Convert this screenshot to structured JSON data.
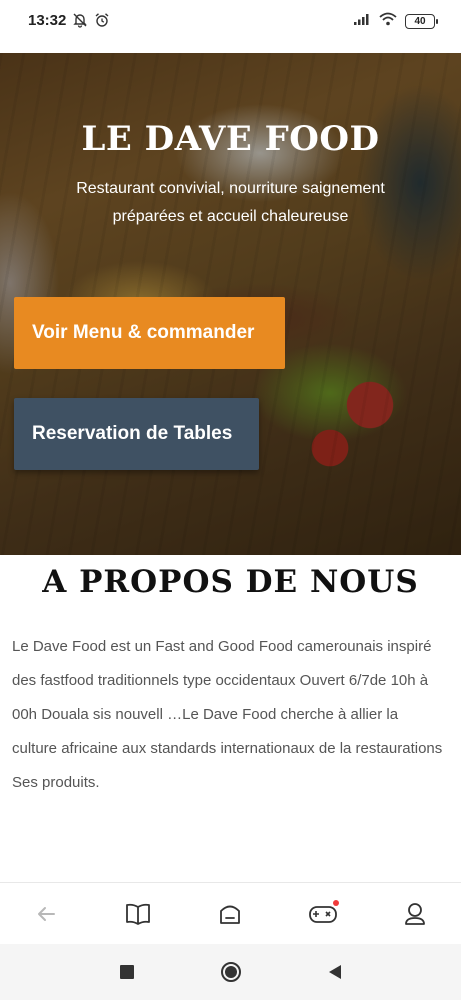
{
  "status_bar": {
    "time": "13:32",
    "battery": "40"
  },
  "hero": {
    "title": "LE DAVE FOOD",
    "subtitle": "Restaurant convivial, nourriture saignement préparées et accueil chaleureuse",
    "menu_button_label": "Voir Menu & commander",
    "reservation_button_label": "Reservation de Tables",
    "colors": {
      "menu_button": "#e88a21",
      "reservation_button": "#3f5163"
    }
  },
  "about": {
    "title": "A PROPOS DE NOUS",
    "text": "Le Dave Food est un  Fast and Good Food camerounais inspiré des fastfood traditionnels type occidentaux Ouvert 6/7de 10h à 00h Douala sis nouvell …Le Dave Food cherche à allier la culture africaine aux standards internationaux de la restaurations Ses produits."
  },
  "browser_nav": {
    "items": [
      "back-arrow-icon",
      "book-icon",
      "home-icon",
      "gamepad-icon",
      "profile-icon"
    ]
  },
  "system_nav": {
    "items": [
      "recents-square-icon",
      "home-circle-icon",
      "back-triangle-icon"
    ]
  }
}
